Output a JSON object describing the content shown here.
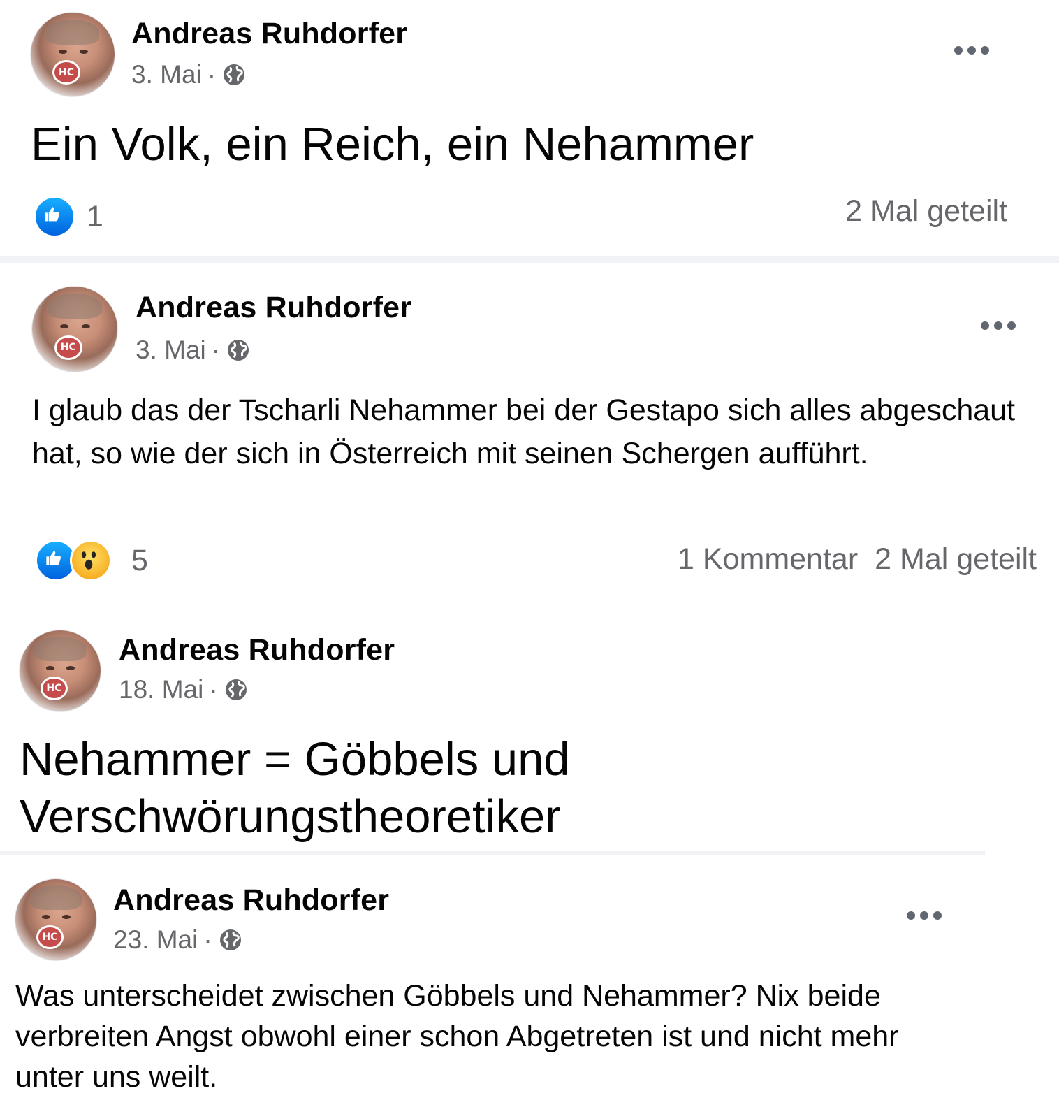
{
  "posts": [
    {
      "author": "Andreas Ruhdorfer",
      "date": "3. Mai",
      "separator": "·",
      "text": "Ein Volk, ein Reich, ein Nehammer",
      "reaction_count": "1",
      "comments": "",
      "shares": "2 Mal geteilt"
    },
    {
      "author": "Andreas Ruhdorfer",
      "date": "3. Mai",
      "separator": "·",
      "text": "I glaub das der Tscharli Nehammer bei der Gestapo sich alles abgeschaut hat, so wie der sich in Österreich mit seinen Schergen aufführt.",
      "reaction_count": "5",
      "comments": "1 Kommentar",
      "shares": "2 Mal geteilt"
    },
    {
      "author": "Andreas Ruhdorfer",
      "date": "18. Mai",
      "separator": "·",
      "text_line1": "Nehammer = Göbbels und",
      "text_line2": "Verschwörungstheoretiker"
    },
    {
      "author": "Andreas Ruhdorfer",
      "date": "23. Mai",
      "separator": "·",
      "text_line1": "Was unterscheidet zwischen Göbbels und Nehammer? Nix beide",
      "text_line2": "verbreiten Angst obwohl einer schon Abgetreten ist und nicht mehr",
      "text_line3": "unter uns weilt."
    }
  ],
  "avatar_badge": "HC",
  "icons": {
    "privacy": "globe-icon",
    "menu": "more-horizontal-icon",
    "like": "like-reaction-icon",
    "wow": "wow-reaction-icon"
  },
  "colors": {
    "text": "#050505",
    "secondary": "#65676b",
    "like_blue": "#1877f2",
    "divider": "#f0f2f5"
  }
}
